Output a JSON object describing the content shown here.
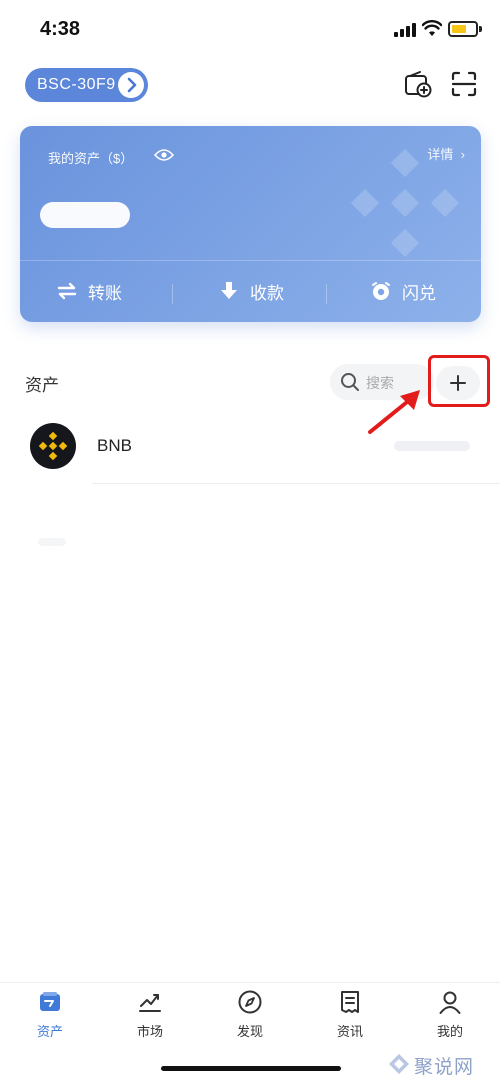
{
  "status_bar": {
    "time": "4:38"
  },
  "header": {
    "network_label": "BSC-30F9"
  },
  "asset_card": {
    "title": "我的资产（$）",
    "detail_link": "详情",
    "actions": {
      "transfer": "转账",
      "receive": "收款",
      "swap": "闪兑"
    }
  },
  "assets_section": {
    "title": "资产",
    "search_placeholder": "搜索",
    "tokens": [
      {
        "symbol": "BNB"
      }
    ]
  },
  "bottom_nav": {
    "items": [
      {
        "label": "资产",
        "icon": "wallet-icon",
        "active": true
      },
      {
        "label": "市场",
        "icon": "chart-icon",
        "active": false
      },
      {
        "label": "发现",
        "icon": "compass-icon",
        "active": false
      },
      {
        "label": "资讯",
        "icon": "news-icon",
        "active": false
      },
      {
        "label": "我的",
        "icon": "user-icon",
        "active": false
      }
    ]
  },
  "watermark": {
    "text": "聚说网"
  },
  "colors": {
    "accent": "#3f7ad8",
    "card": "#6a93dd",
    "highlight": "#e21b1b",
    "bnb": "#f0b90b"
  }
}
